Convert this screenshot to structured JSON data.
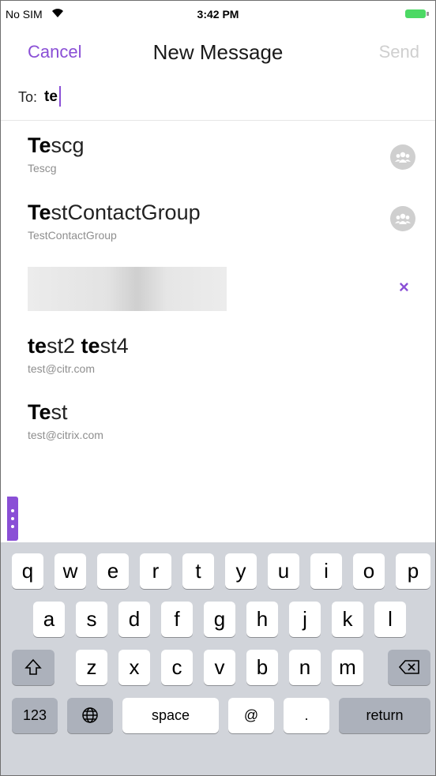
{
  "status_bar": {
    "carrier": "No SIM",
    "time": "3:42 PM"
  },
  "nav": {
    "cancel_label": "Cancel",
    "title": "New Message",
    "send_label": "Send"
  },
  "to_field": {
    "label": "To:",
    "value": "te"
  },
  "contacts": [
    {
      "name_match": "Te",
      "name_rest": "scg",
      "subtitle": "Tescg",
      "icon": "group-icon"
    },
    {
      "name_match": "Te",
      "name_rest": "stContactGroup",
      "subtitle": "TestContactGroup",
      "icon": "group-icon"
    },
    {
      "name_match": "te",
      "name_rest": "st2 ",
      "name_match2": "te",
      "name_rest2": "st4",
      "subtitle": "test@citr.com"
    },
    {
      "name_match": "Te",
      "name_rest": "st",
      "subtitle": "test@citrix.com"
    }
  ],
  "selected_recipient": {
    "remove_icon": "close-icon",
    "remove_label": "×"
  },
  "keyboard": {
    "row1": [
      "q",
      "w",
      "e",
      "r",
      "t",
      "y",
      "u",
      "i",
      "o",
      "p"
    ],
    "row2": [
      "a",
      "s",
      "d",
      "f",
      "g",
      "h",
      "j",
      "k",
      "l"
    ],
    "row3": [
      "z",
      "x",
      "c",
      "v",
      "b",
      "n",
      "m"
    ],
    "numbers_label": "123",
    "space_label": "space",
    "at_label": "@",
    "period_label": ".",
    "return_label": "return"
  },
  "colors": {
    "accent": "#8a4fd6",
    "disabled": "#cfcfcf",
    "keyboard_bg": "#d1d4da"
  }
}
